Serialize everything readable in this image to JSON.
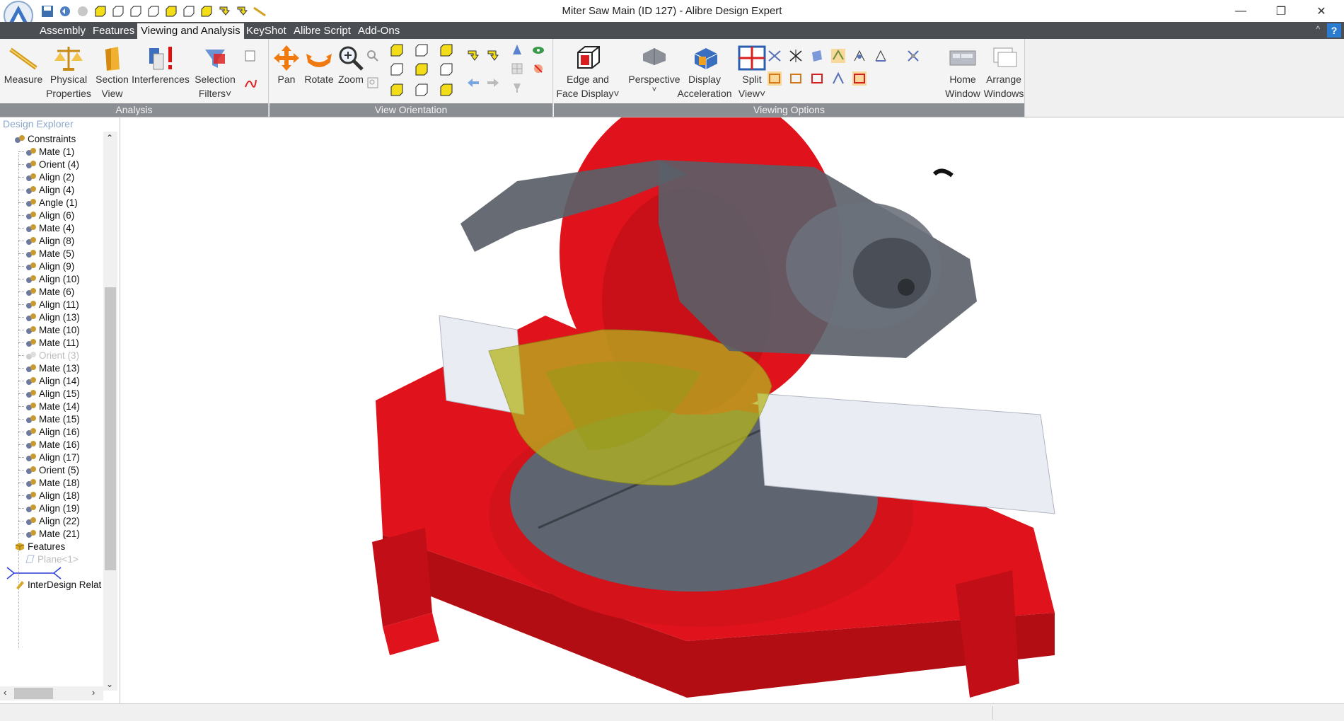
{
  "window": {
    "title": "Miter Saw Main (ID 127) - Alibre Design Expert",
    "minimize": "—",
    "restore": "❐",
    "close": "✕"
  },
  "tabs": [
    {
      "label": "Assembly"
    },
    {
      "label": "Features"
    },
    {
      "label": "Viewing and Analysis",
      "active": true
    },
    {
      "label": "KeyShot"
    },
    {
      "label": "Alibre Script"
    },
    {
      "label": "Add-Ons"
    }
  ],
  "help_label": "?",
  "ribbon": {
    "analysis": {
      "label": "Analysis",
      "measure": "Measure",
      "physical_1": "Physical",
      "physical_2": "Properties",
      "section_1": "Section",
      "section_2": "View",
      "interferences": "Interferences",
      "selection_1": "Selection",
      "selection_2": "Filters˅"
    },
    "view_orientation": {
      "label": "View Orientation",
      "pan": "Pan",
      "rotate": "Rotate",
      "zoom": "Zoom"
    },
    "viewing_options": {
      "label": "Viewing Options",
      "edge_1": "Edge and",
      "edge_2": "Face Display˅",
      "perspective": "Perspective",
      "perspective_arrow": "˅",
      "display_1": "Display",
      "display_2": "Acceleration",
      "split_1": "Split",
      "split_2": "View˅",
      "home_1": "Home",
      "home_2": "Window",
      "arrange_1": "Arrange",
      "arrange_2": "Windows"
    }
  },
  "explorer": {
    "title": "Design Explorer",
    "items": [
      {
        "label": "Constraints"
      },
      {
        "label": "Mate (1)"
      },
      {
        "label": "Orient (4)"
      },
      {
        "label": "Align (2)"
      },
      {
        "label": "Align (4)"
      },
      {
        "label": "Angle (1)"
      },
      {
        "label": "Align (6)"
      },
      {
        "label": "Mate (4)"
      },
      {
        "label": "Align (8)"
      },
      {
        "label": "Mate (5)"
      },
      {
        "label": "Align (9)"
      },
      {
        "label": "Align (10)"
      },
      {
        "label": "Mate (6)"
      },
      {
        "label": "Align (11)"
      },
      {
        "label": "Align (13)"
      },
      {
        "label": "Mate (10)"
      },
      {
        "label": "Mate (11)"
      },
      {
        "label": "Orient (3)"
      },
      {
        "label": "Mate (13)"
      },
      {
        "label": "Align (14)"
      },
      {
        "label": "Align (15)"
      },
      {
        "label": "Mate (14)"
      },
      {
        "label": "Mate (15)"
      },
      {
        "label": "Align (16)"
      },
      {
        "label": "Mate (16)"
      },
      {
        "label": "Align (17)"
      },
      {
        "label": "Orient (5)"
      },
      {
        "label": "Mate (18)"
      },
      {
        "label": "Align (18)"
      },
      {
        "label": "Align (19)"
      },
      {
        "label": "Align (22)"
      },
      {
        "label": "Mate (21)"
      },
      {
        "label": "Features"
      },
      {
        "label": "Plane<1>"
      },
      {
        "label": "InterDesign Relat"
      }
    ]
  },
  "colors": {
    "saw_red": "#e0121b",
    "motor_gray": "#5a5f68",
    "blade_guard": "#b5b51e",
    "fence": "#e9ecf2",
    "tab_bar": "#4b4e53"
  }
}
